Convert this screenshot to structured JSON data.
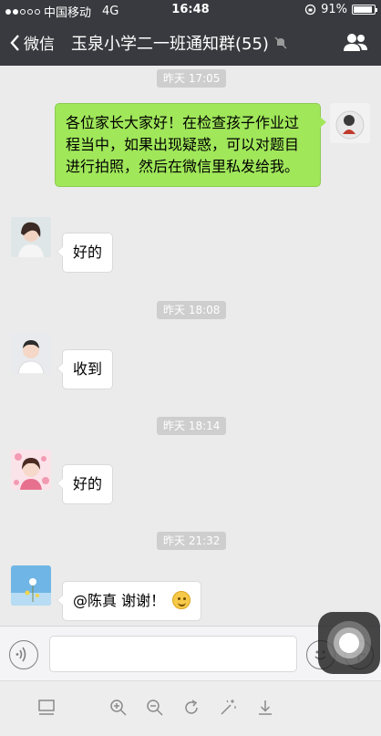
{
  "status_bar": {
    "carrier": "中国移动",
    "network": "4G",
    "time": "16:48",
    "battery": "91%"
  },
  "nav": {
    "back_label": "微信",
    "title": "玉泉小学二一班通知群(55)",
    "muted_icon": "mute-bell-icon",
    "contacts_icon": "group-members-icon"
  },
  "messages": [
    {
      "type": "timestamp",
      "text": "昨天 17:05"
    },
    {
      "type": "outgoing",
      "text": "各位家长大家好！在检查孩子作业过程当中，如果出现疑惑，可以对题目进行拍照，然后在微信里私发给我。"
    },
    {
      "type": "incoming",
      "text": "好的"
    },
    {
      "type": "timestamp",
      "text": "昨天 18:08"
    },
    {
      "type": "incoming",
      "text": "收到"
    },
    {
      "type": "timestamp",
      "text": "昨天 18:14"
    },
    {
      "type": "incoming",
      "text": "好的"
    },
    {
      "type": "timestamp",
      "text": "昨天 21:32"
    },
    {
      "type": "incoming",
      "text": "@陈真 谢谢！",
      "emoji": "smile-emoji"
    }
  ],
  "input_bar": {
    "voice_icon": "voice-icon",
    "text_value": "",
    "emoji_icon": "emoji-face-icon",
    "plus_icon": "plus-icon"
  },
  "toolbar": {
    "icons": [
      "screen-icon",
      "zoom-in-icon",
      "zoom-out-icon",
      "rotate-icon",
      "magic-wand-icon",
      "download-icon"
    ]
  },
  "colors": {
    "bar": "#393a3f",
    "chat_bg": "#ebebeb",
    "outgoing_bubble": "#a0e75a",
    "incoming_bubble": "#ffffff",
    "timestamp_bg": "#cecece"
  }
}
